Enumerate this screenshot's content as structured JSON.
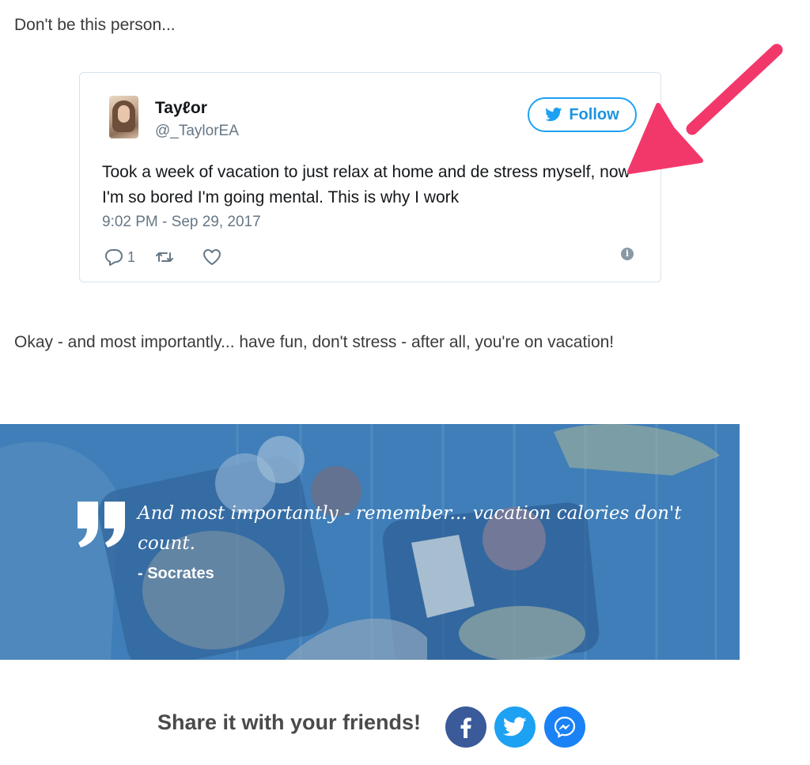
{
  "intro_text": "Don't be this person...",
  "tweet": {
    "name": "Tayℓor",
    "handle": "@_TaylorEA",
    "follow_label": "Follow",
    "text": "Took a week of vacation to just relax at home and de stress myself, now I'm so bored I'm going mental. This is why I work",
    "timestamp": "9:02 PM - Sep 29, 2017",
    "reply_count": "1",
    "info_glyph": "i"
  },
  "after_tweet_text": "Okay - and most importantly... have fun, don't stress - after all, you're on vacation!",
  "quote": {
    "text": "And most importantly - remember... vacation calories don't count.",
    "author": "- Socrates"
  },
  "share": {
    "label": "Share it with your friends!",
    "buttons": [
      "facebook",
      "twitter",
      "messenger"
    ]
  },
  "colors": {
    "twitter_blue": "#1da1f2",
    "arrow_pink": "#f2386b",
    "banner_overlay": "#3a79b4",
    "facebook": "#3b5a9a",
    "messenger": "#1a82f5"
  }
}
